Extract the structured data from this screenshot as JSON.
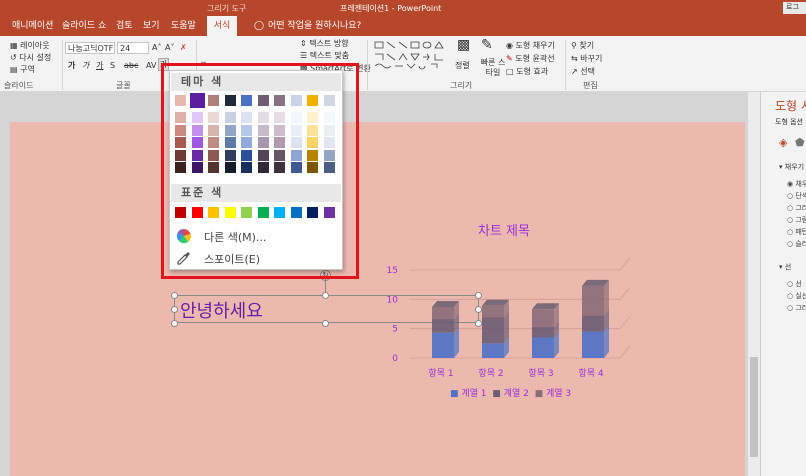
{
  "titlebar": {
    "context_label": "그리기 도구",
    "title": "프레젠테이션1 - PowerPoint",
    "right_label": "로그"
  },
  "tabs": [
    "애니메이션",
    "슬라이드 쇼",
    "검토",
    "보기",
    "도움말",
    "서식"
  ],
  "tell_me": "어떤 작업을 원하시나요?",
  "ribbon": {
    "layout": "레이아웃",
    "reset": "다시 설정",
    "section": "구역",
    "group_slides": "슬라이드",
    "font_name": "나눔고딕OTF",
    "font_size": "24",
    "group_font": "글꼴",
    "text_direction": "텍스트 방향",
    "text_align": "텍스트 맞춤",
    "smartart": "SmartArt로 변환",
    "arrange": "정렬",
    "quick_styles": "빠른 스타일",
    "shape_fill": "도형 채우기",
    "shape_outline": "도형 윤곽선",
    "shape_effects": "도형 효과",
    "group_drawing": "그리기",
    "find": "찾기",
    "replace": "바꾸기",
    "select": "선택",
    "group_editing": "편집"
  },
  "color_menu": {
    "theme_header": "테마 색",
    "standard_header": "표준 색",
    "more_colors": "다른 색(M)...",
    "eyedropper": "스포이트(E)",
    "theme_top_row": [
      "#e8b7ae",
      "#5a1fa0",
      "#b07f7a",
      "#1f2a3d",
      "#4b73c4",
      "#6e5d74",
      "#8a7286",
      "#c8d4ea",
      "#f2b300",
      "#cfd7e5"
    ],
    "theme_columns": [
      [
        "#ddb1a8",
        "#cb8a7e",
        "#a65b4e",
        "#6e3c34",
        "#3d211c"
      ],
      [
        "#e1c7f5",
        "#c390ec",
        "#a057e2",
        "#6a2ba6",
        "#3e1563"
      ],
      [
        "#ead8d5",
        "#d6b3ad",
        "#bf8c84",
        "#8c5a52",
        "#54342f"
      ],
      [
        "#c9d2e2",
        "#93a6c6",
        "#5e7aa6",
        "#2e3e5c",
        "#161e2d"
      ],
      [
        "#dbe3f3",
        "#b7c7e8",
        "#90abdc",
        "#2c4f9a",
        "#1a2f5c"
      ],
      [
        "#e2dde4",
        "#c5bac9",
        "#a797ad",
        "#524559",
        "#302834"
      ],
      [
        "#e6dde4",
        "#cdbcc9",
        "#b39aae",
        "#665464",
        "#3d323c"
      ],
      [
        "#f3f6fb",
        "#e8edf6",
        "#dde4f1",
        "#8fa6d2",
        "#3d5a95"
      ],
      [
        "#fff0cc",
        "#ffe199",
        "#ffd266",
        "#b88300",
        "#7a5700"
      ],
      [
        "#f5f7fa",
        "#ebeff5",
        "#e1e7f0",
        "#94a6c3",
        "#4b5f80"
      ]
    ],
    "standard_colors": [
      "#c00000",
      "#ff0000",
      "#ffc000",
      "#ffff00",
      "#92d050",
      "#00b050",
      "#00b0f0",
      "#0070c0",
      "#002060",
      "#7030a0"
    ]
  },
  "slide": {
    "textbox_text": "안녕하세요"
  },
  "chart_data": {
    "type": "bar",
    "title": "차트 제목",
    "categories": [
      "항목 1",
      "항목 2",
      "항목 3",
      "항목 4"
    ],
    "series": [
      {
        "name": "계열 1",
        "values": [
          4.3,
          2.5,
          3.5,
          4.5
        ],
        "color": "#4f72c6"
      },
      {
        "name": "계열 2",
        "values": [
          2.4,
          4.4,
          1.8,
          2.8
        ],
        "color": "#6e5d74"
      },
      {
        "name": "계열 3",
        "values": [
          2,
          2,
          3,
          5
        ],
        "color": "#8a6d7a"
      }
    ],
    "y_ticks": [
      "15",
      "10",
      "5",
      "0"
    ],
    "ylim": [
      0,
      15
    ],
    "legend_position": "bottom",
    "stacked": true,
    "three_d": true
  },
  "pane": {
    "title": "도형 서",
    "subtitle": "도형 옵션",
    "section_fill": "채우기",
    "fill_options": [
      "채우",
      "단색",
      "그라",
      "그림",
      "패턴",
      "슬라"
    ],
    "section_line": "선",
    "line_options": [
      "선",
      "실선",
      "그라"
    ]
  }
}
